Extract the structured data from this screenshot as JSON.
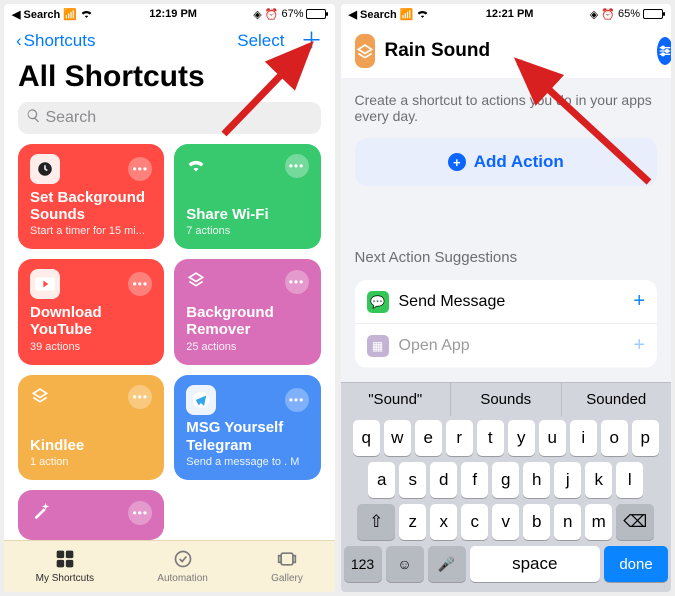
{
  "left": {
    "status": {
      "carrier": "Search",
      "time": "12:19 PM",
      "battery": "67%"
    },
    "nav": {
      "back": "Shortcuts",
      "select": "Select"
    },
    "title": "All Shortcuts",
    "search_placeholder": "Search",
    "cards": [
      {
        "title": "Set Background Sounds",
        "sub": "Start a timer for 15 mi...",
        "color": "#ff4b44",
        "icon": "clock-icon"
      },
      {
        "title": "Share Wi-Fi",
        "sub": "7 actions",
        "color": "#38c96f",
        "icon": "wifi-icon"
      },
      {
        "title": "Download YouTube",
        "sub": "39 actions",
        "color": "#ff4b44",
        "icon": "youtube-icon"
      },
      {
        "title": "Background Remover",
        "sub": "25 actions",
        "color": "#d96fb8",
        "icon": "layers-icon"
      },
      {
        "title": "Kindlee",
        "sub": "1 action",
        "color": "#f6b24a",
        "icon": "layers-icon"
      },
      {
        "title": "MSG Yourself Telegram",
        "sub": "Send a message to . M",
        "color": "#4a8ff6",
        "icon": "telegram-icon"
      }
    ],
    "extra_card_icon": "wand-icon",
    "tabs": {
      "my": "My Shortcuts",
      "auto": "Automation",
      "gallery": "Gallery"
    }
  },
  "right": {
    "status": {
      "carrier": "Search",
      "time": "12:21 PM",
      "battery": "65%"
    },
    "name": "Rain Sound",
    "hint": "Create a shortcut to actions you do in your apps every day.",
    "add_action": "Add Action",
    "suggest_title": "Next Action Suggestions",
    "suggestions": [
      {
        "label": "Send Message",
        "color": "#33c759"
      },
      {
        "label": "Open App",
        "color": "#6b4393"
      }
    ],
    "predictions": [
      "\"Sound\"",
      "Sounds",
      "Sounded"
    ],
    "keys": {
      "r1": [
        "q",
        "w",
        "e",
        "r",
        "t",
        "y",
        "u",
        "i",
        "o",
        "p"
      ],
      "r2": [
        "a",
        "s",
        "d",
        "f",
        "g",
        "h",
        "j",
        "k",
        "l"
      ],
      "r3": [
        "z",
        "x",
        "c",
        "v",
        "b",
        "n",
        "m"
      ],
      "num": "123",
      "space": "space",
      "done": "done"
    }
  }
}
